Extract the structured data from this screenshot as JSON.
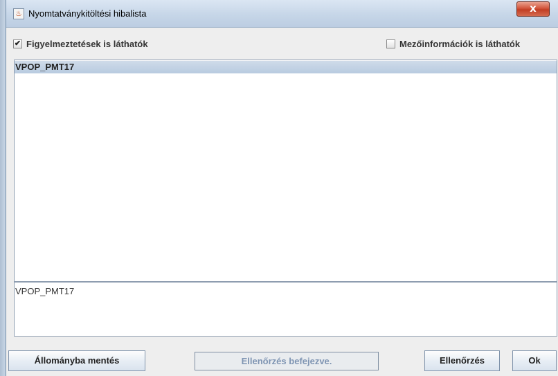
{
  "window": {
    "title": "Nyomtatványkitöltési hibalista",
    "app_icon": "java-icon",
    "close_label": "x"
  },
  "options": {
    "warnings": {
      "label": "Figyelmeztetések is láthatók",
      "checked": true
    },
    "field_info": {
      "label": "Mezőinformációk is láthatók",
      "checked": false
    }
  },
  "list": {
    "items": [
      {
        "label": "VPOP_PMT17",
        "selected": true
      }
    ]
  },
  "detail": {
    "text": "VPOP_PMT17"
  },
  "footer": {
    "save_label": "Állományba mentés",
    "status_text": "Ellenőrzés befejezve.",
    "check_label": "Ellenőrzés",
    "ok_label": "Ok"
  },
  "colors": {
    "selection": "#c1d2e6",
    "status_text": "#7f95b3",
    "close_button": "#c9472c"
  }
}
